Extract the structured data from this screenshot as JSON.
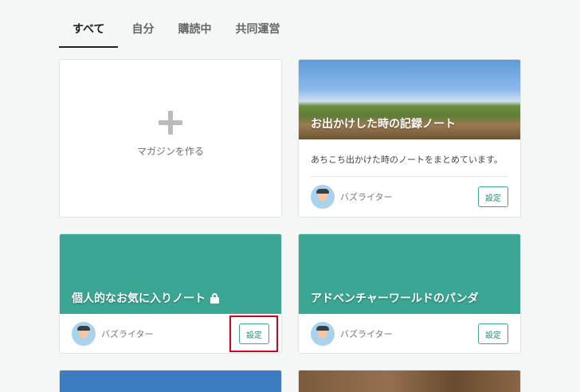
{
  "tabs": [
    {
      "label": "すべて",
      "active": true
    },
    {
      "label": "自分",
      "active": false
    },
    {
      "label": "購読中",
      "active": false
    },
    {
      "label": "共同運営",
      "active": false
    }
  ],
  "create_card": {
    "label": "マガジンを作る",
    "icon": "plus-icon"
  },
  "magazines": [
    {
      "title": "お出かけした時の記録ノート",
      "description": "あちこち出かけた時のノートをまとめています。",
      "author": "バズライター",
      "settings_label": "設定",
      "cover": "photo"
    },
    {
      "title": "個人的なお気に入りノート",
      "private": true,
      "author": "バズライター",
      "settings_label": "設定",
      "cover": "teal"
    },
    {
      "title": "アドベンチャーワールドのパンダ",
      "author": "バズライター",
      "settings_label": "設定",
      "cover": "teal"
    }
  ],
  "colors": {
    "accent": "#3aa693",
    "highlight": "#d0021b",
    "background": "#f5f6f6"
  }
}
